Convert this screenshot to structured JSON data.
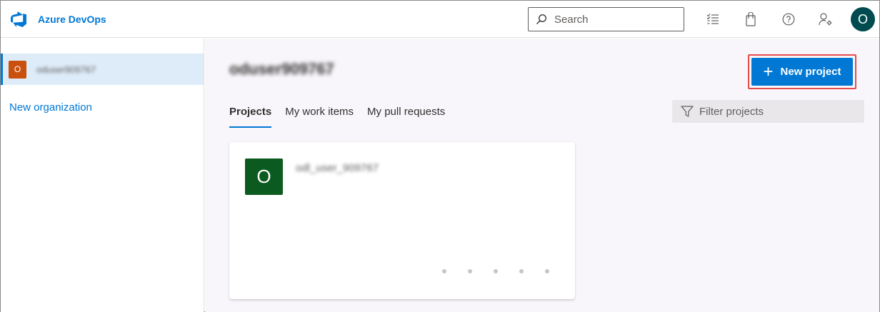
{
  "header": {
    "brand_name": "Azure DevOps",
    "search_placeholder": "Search",
    "icons": [
      "work-items-list-icon",
      "marketplace-bag-icon",
      "help-icon",
      "user-settings-icon"
    ],
    "user_avatar_initial": "O",
    "accent": "#0078d4"
  },
  "sidebar": {
    "organization": {
      "avatar_initial": "O",
      "name": "oduser909767",
      "avatar_color": "#ca5010"
    },
    "new_org_label": "New organization"
  },
  "main": {
    "org_title": "oduser909767",
    "new_project_label": "New project",
    "tabs": [
      {
        "label": "Projects",
        "active": true
      },
      {
        "label": "My work items",
        "active": false
      },
      {
        "label": "My pull requests",
        "active": false
      }
    ],
    "filter_placeholder": "Filter projects",
    "project_card": {
      "avatar_initial": "O",
      "name": "odl_user_909767",
      "avatar_color": "#0b5a1f"
    }
  }
}
